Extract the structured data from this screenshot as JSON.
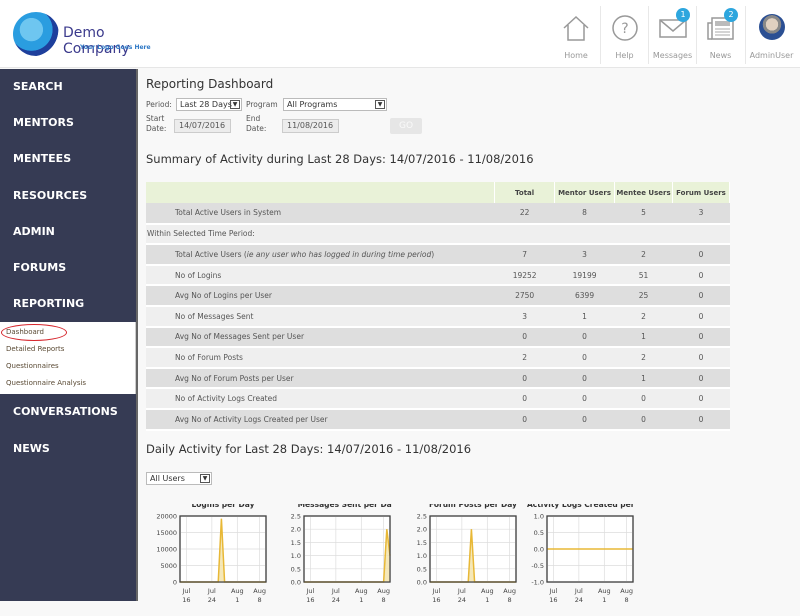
{
  "header": {
    "company": "Demo Company",
    "tagline": "Your Logo Goes Here",
    "nav": [
      {
        "label": "Home",
        "icon": "home-icon"
      },
      {
        "label": "Help",
        "icon": "help-icon"
      },
      {
        "label": "Messages",
        "icon": "envelope-icon",
        "badge": "1"
      },
      {
        "label": "News",
        "icon": "newspaper-icon",
        "badge": "2"
      },
      {
        "label": "AdminUser",
        "icon": "avatar"
      }
    ]
  },
  "sidebar": {
    "items": [
      "SEARCH",
      "MENTORS",
      "MENTEES",
      "RESOURCES",
      "ADMIN",
      "FORUMS",
      "REPORTING"
    ],
    "submenu": [
      "Dashboard",
      "Detailed Reports",
      "Questionnaires",
      "Questionnaire Analysis"
    ],
    "items_after": [
      "CONVERSATIONS",
      "NEWS"
    ]
  },
  "main": {
    "title": "Reporting Dashboard",
    "period_label": "Period:",
    "period_value": "Last 28 Days",
    "program_label": "Program",
    "program_value": "All Programs",
    "start_label1": "Start",
    "start_label2": "Date:",
    "start_value": "14/07/2016",
    "end_label1": "End",
    "end_label2": "Date:",
    "end_value": "11/08/2016",
    "go": "GO",
    "summary_title": "Summary of Activity during Last 28 Days: 14/07/2016 - 11/08/2016",
    "table": {
      "headers": [
        "",
        "Total",
        "Mentor Users",
        "Mentee Users",
        "Forum Users"
      ],
      "rows": [
        {
          "label": "Total Active Users in System",
          "values": [
            "22",
            "8",
            "5",
            "3"
          ]
        },
        {
          "label": "Within Selected Time Period:",
          "values": [
            "",
            "",
            "",
            ""
          ],
          "heading": true
        },
        {
          "label": "Total Active Users (",
          "italic": "ie any user who has logged in during time period",
          "after": ")",
          "values": [
            "7",
            "3",
            "2",
            "0"
          ]
        },
        {
          "label": "No of Logins",
          "values": [
            "19252",
            "19199",
            "51",
            "0"
          ]
        },
        {
          "label": "Avg No of Logins per User",
          "values": [
            "2750",
            "6399",
            "25",
            "0"
          ]
        },
        {
          "label": "No of Messages Sent",
          "values": [
            "3",
            "1",
            "2",
            "0"
          ]
        },
        {
          "label": "Avg No of Messages Sent per User",
          "values": [
            "0",
            "0",
            "1",
            "0"
          ]
        },
        {
          "label": "No of Forum Posts",
          "values": [
            "2",
            "0",
            "2",
            "0"
          ]
        },
        {
          "label": "Avg No of Forum Posts per User",
          "values": [
            "0",
            "0",
            "1",
            "0"
          ]
        },
        {
          "label": "No of Activity Logs Created",
          "values": [
            "0",
            "0",
            "0",
            "0"
          ]
        },
        {
          "label": "Avg No of Activity Logs Created per User",
          "values": [
            "0",
            "0",
            "0",
            "0"
          ]
        }
      ]
    },
    "daily_title": "Daily Activity for Last 28 Days: 14/07/2016 - 11/08/2016",
    "users_select": "All Users"
  },
  "chart_data": [
    {
      "type": "area",
      "title": "Logins per Day",
      "yticks": [
        "0",
        "5000",
        "10000",
        "15000",
        "20000"
      ],
      "ylim": [
        0,
        20000
      ],
      "xticks": [
        "Jul 16",
        "Jul 24",
        "Aug 1",
        "Aug 8"
      ],
      "x_days": [
        0,
        27
      ],
      "values_by_day": [
        0,
        0,
        0,
        0,
        0,
        0,
        0,
        0,
        0,
        0,
        0,
        0,
        0,
        19200,
        0,
        0,
        0,
        0,
        0,
        0,
        0,
        0,
        0,
        0,
        0,
        0,
        0,
        0
      ]
    },
    {
      "type": "area",
      "title": "Messages Sent per Day",
      "yticks": [
        "0.0",
        "0.5",
        "1.0",
        "1.5",
        "2.0",
        "2.5"
      ],
      "ylim": [
        0,
        2.5
      ],
      "xticks": [
        "Jul 16",
        "Jul 24",
        "Aug 1",
        "Aug 8"
      ],
      "values_by_day": [
        0,
        0,
        0,
        0,
        0,
        0,
        0,
        0,
        0,
        0,
        0,
        0,
        0,
        0,
        0,
        0,
        0,
        0,
        0,
        0,
        0,
        0,
        0,
        0,
        0,
        0,
        2,
        1
      ]
    },
    {
      "type": "area",
      "title": "Forum Posts per Day",
      "yticks": [
        "0.0",
        "0.5",
        "1.0",
        "1.5",
        "2.0",
        "2.5"
      ],
      "ylim": [
        0,
        2.5
      ],
      "xticks": [
        "Jul 16",
        "Jul 24",
        "Aug 1",
        "Aug 8"
      ],
      "values_by_day": [
        0,
        0,
        0,
        0,
        0,
        0,
        0,
        0,
        0,
        0,
        0,
        0,
        0,
        2,
        0,
        0,
        0,
        0,
        0,
        0,
        0,
        0,
        0,
        0,
        0,
        0,
        0,
        0
      ]
    },
    {
      "type": "line",
      "title": "Activity Logs Created per Day",
      "yticks": [
        "-1.0",
        "-0.5",
        "0.0",
        "0.5",
        "1.0"
      ],
      "ylim": [
        -1,
        1
      ],
      "xticks": [
        "Jul 16",
        "Jul 24",
        "Aug 1",
        "Aug 8"
      ],
      "values_by_day": [
        0,
        0,
        0,
        0,
        0,
        0,
        0,
        0,
        0,
        0,
        0,
        0,
        0,
        0,
        0,
        0,
        0,
        0,
        0,
        0,
        0,
        0,
        0,
        0,
        0,
        0,
        0,
        0
      ]
    }
  ]
}
